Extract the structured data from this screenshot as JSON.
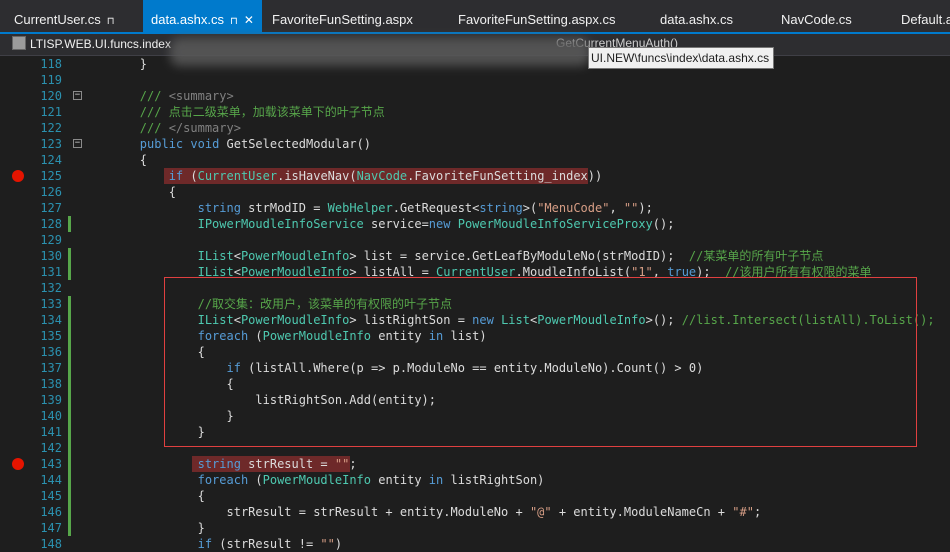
{
  "tabs": [
    {
      "label": "CurrentUser.cs",
      "pin": true,
      "active": false
    },
    {
      "label": "data.ashx.cs",
      "pin": true,
      "close": true,
      "active": true
    },
    {
      "label": "FavoriteFunSetting.aspx",
      "active": false
    },
    {
      "label": "FavoriteFunSetting.aspx.cs",
      "active": false
    },
    {
      "label": "data.ashx.cs",
      "active": false
    },
    {
      "label": "NavCode.cs",
      "active": false
    },
    {
      "label": "Default.a",
      "active": false
    }
  ],
  "nav": {
    "project": "LTISP.WEB.UI.funcs.index",
    "member": "GetCurrentMenuAuth()"
  },
  "tooltip": "UI.NEW\\funcs\\index\\data.ashx.cs",
  "lines": [
    {
      "n": "118",
      "text": "        }"
    },
    {
      "n": "119",
      "text": ""
    },
    {
      "n": "120",
      "text": "        /// <summary>"
    },
    {
      "n": "121",
      "text": "        /// 点击二级菜单，加载该菜单下的叶子节点"
    },
    {
      "n": "122",
      "text": "        /// </summary>"
    },
    {
      "n": "123",
      "text": "        public void GetSelectedModular()"
    },
    {
      "n": "124",
      "text": "        {"
    },
    {
      "n": "125",
      "text": "            if (CurrentUser.isHaveNav(NavCode.FavoriteFunSetting_index))"
    },
    {
      "n": "126",
      "text": "            {"
    },
    {
      "n": "127",
      "text": "                string strModID = WebHelper.GetRequest<string>(\"MenuCode\", \"\");"
    },
    {
      "n": "128",
      "text": "                IPowerMoudleInfoService service=new PowerMoudleInfoServiceProxy();"
    },
    {
      "n": "129",
      "text": ""
    },
    {
      "n": "130",
      "text": "                IList<PowerMoudleInfo> list = service.GetLeafByModuleNo(strModID);  //某菜单的所有叶子节点"
    },
    {
      "n": "131",
      "text": "                IList<PowerMoudleInfo> listAll = CurrentUser.MoudleInfoList(\"1\", true);  //该用户所有有权限的菜单"
    },
    {
      "n": "132",
      "text": ""
    },
    {
      "n": "133",
      "text": "                //取交集：改用户，该菜单的有权限的叶子节点"
    },
    {
      "n": "134",
      "text": "                IList<PowerMoudleInfo> listRightSon = new List<PowerMoudleInfo>(); //list.Intersect(listAll).ToList();"
    },
    {
      "n": "135",
      "text": "                foreach (PowerMoudleInfo entity in list)"
    },
    {
      "n": "136",
      "text": "                {"
    },
    {
      "n": "137",
      "text": "                    if (listAll.Where(p => p.ModuleNo == entity.ModuleNo).Count() > 0)"
    },
    {
      "n": "138",
      "text": "                    {"
    },
    {
      "n": "139",
      "text": "                        listRightSon.Add(entity);"
    },
    {
      "n": "140",
      "text": "                    }"
    },
    {
      "n": "141",
      "text": "                }"
    },
    {
      "n": "142",
      "text": ""
    },
    {
      "n": "143",
      "text": "                string strResult = \"\";"
    },
    {
      "n": "144",
      "text": "                foreach (PowerMoudleInfo entity in listRightSon)"
    },
    {
      "n": "145",
      "text": "                {"
    },
    {
      "n": "146",
      "text": "                    strResult = strResult + entity.ModuleNo + \"@\" + entity.ModuleNameCn + \"#\";"
    },
    {
      "n": "147",
      "text": "                }"
    },
    {
      "n": "148",
      "text": "                if (strResult != \"\")"
    }
  ],
  "colors": {
    "accent": "#007acc",
    "breakpoint": "#e51400",
    "highlight": "#6e2929",
    "changed": "#57a64a"
  }
}
